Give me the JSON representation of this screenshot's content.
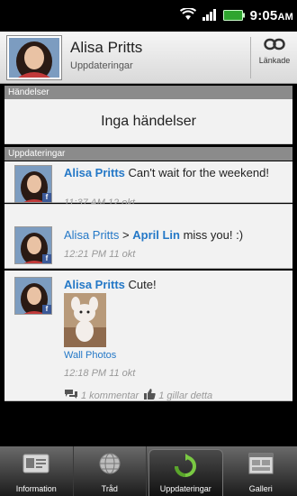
{
  "status_bar": {
    "time": "9:05",
    "ampm": "AM",
    "icons": [
      "wifi-icon",
      "signal-icon",
      "battery-icon"
    ]
  },
  "header": {
    "name": "Alisa Pritts",
    "subtitle": "Uppdateringar",
    "linked_label": "Länkade"
  },
  "events": {
    "section_title": "Händelser",
    "empty_text": "Inga händelser"
  },
  "updates": {
    "section_title": "Uppdateringar",
    "items": [
      {
        "author": "Alisa Pritts",
        "message": " Can't wait for the weekend!",
        "time": "11:37 AM 12 okt"
      },
      {
        "author": "Alisa Pritts",
        "separator": " > ",
        "target": "April Lin",
        "message": " miss you! :)",
        "time": "12:21 PM 11 okt"
      },
      {
        "author": "Alisa Pritts",
        "message": " Cute!",
        "photo_link": "Wall Photos",
        "time": "12:18 PM 11 okt",
        "comments": "1 kommentar",
        "likes": "1 gillar detta"
      }
    ]
  },
  "tabs": [
    {
      "label": "Information",
      "icon": "info-card-icon"
    },
    {
      "label": "Tråd",
      "icon": "thread-globe-icon"
    },
    {
      "label": "Uppdateringar",
      "icon": "refresh-icon",
      "active": true
    },
    {
      "label": "Galleri",
      "icon": "gallery-icon"
    }
  ],
  "colors": {
    "link": "#2478c7",
    "section_bar": "#8b8b8b",
    "facebook": "#3b5998",
    "refresh_green": "#7ac943"
  }
}
